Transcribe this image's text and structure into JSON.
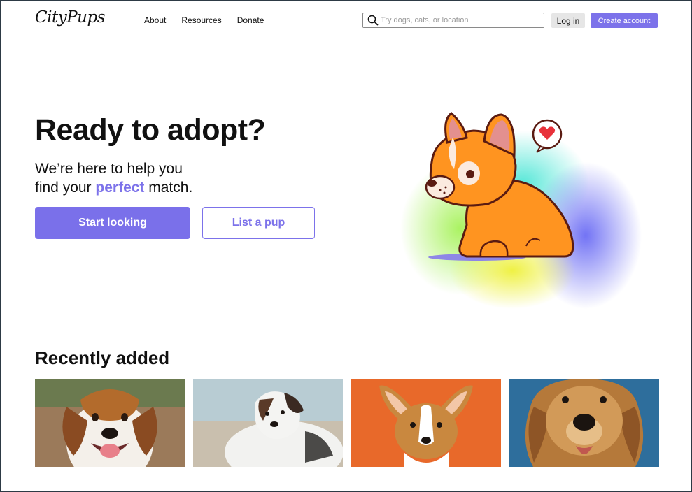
{
  "header": {
    "logo": "CityPups",
    "nav": [
      {
        "label": "About"
      },
      {
        "label": "Resources"
      },
      {
        "label": "Donate"
      }
    ],
    "search": {
      "placeholder": "Try dogs, cats, or location",
      "icon": "search-icon"
    },
    "login_label": "Log in",
    "create_account_label": "Create account"
  },
  "hero": {
    "title": "Ready to adopt?",
    "subtitle_line1": "We’re here to help you",
    "subtitle_line2_before": "find your ",
    "subtitle_accent": "perfect",
    "subtitle_line2_after": " match.",
    "primary_button": "Start looking",
    "secondary_button": "List a pup"
  },
  "recent": {
    "title": "Recently added",
    "photos": [
      {
        "icon": "beagle-photo"
      },
      {
        "icon": "australian-shepherd-photo"
      },
      {
        "icon": "corgi-photo"
      },
      {
        "icon": "golden-retriever-photo"
      }
    ]
  },
  "colors": {
    "accent": "#7c72ea",
    "border": "#2d3a45"
  }
}
